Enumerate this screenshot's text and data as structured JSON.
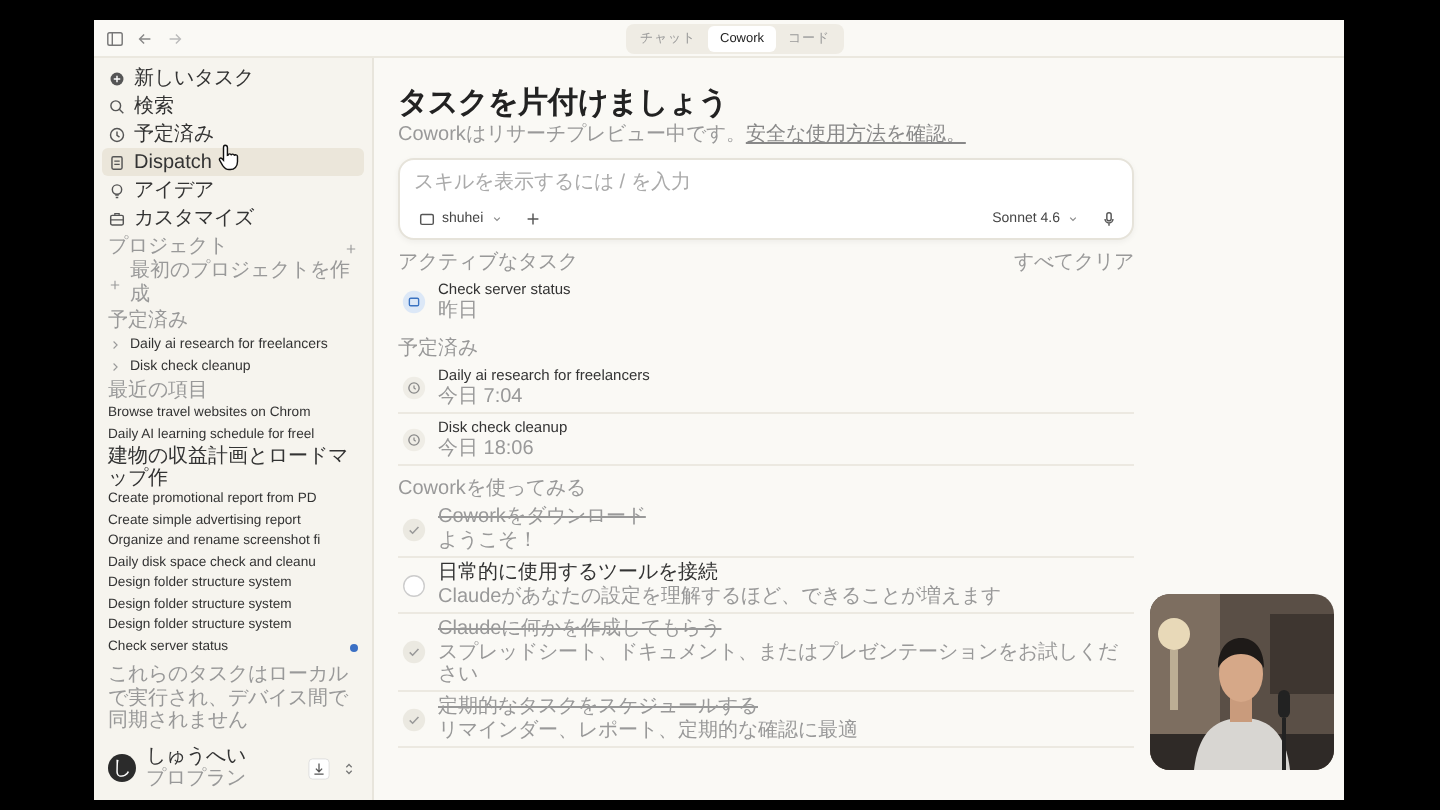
{
  "top_tabs": [
    {
      "label": "チャット",
      "selected": false
    },
    {
      "label": "Cowork",
      "selected": true
    },
    {
      "label": "コード",
      "selected": false
    }
  ],
  "sidebar": {
    "nav": [
      {
        "label": "新しいタスク",
        "selected": false
      },
      {
        "label": "検索",
        "selected": false
      },
      {
        "label": "予定済み",
        "selected": false
      },
      {
        "label": "Dispatch",
        "selected": true
      },
      {
        "label": "アイデア",
        "selected": false
      },
      {
        "label": "カスタマイズ",
        "selected": false
      }
    ],
    "projects": {
      "title": "プロジェクト",
      "create": "最初のプロジェクトを作成"
    },
    "scheduled": {
      "title": "予定済み",
      "items": [
        "Daily ai research for freelancers",
        "Disk check cleanup"
      ]
    },
    "recents": {
      "title": "最近の項目",
      "items": [
        {
          "label": "Browse travel websites on Chrom",
          "running": false
        },
        {
          "label": "Daily AI learning schedule for freel",
          "running": false
        },
        {
          "label": "建物の収益計画とロードマップ作",
          "running": false
        },
        {
          "label": "Create promotional report from PD",
          "running": false
        },
        {
          "label": "Create simple advertising report",
          "running": false
        },
        {
          "label": "Organize and rename screenshot fi",
          "running": false
        },
        {
          "label": "Daily disk space check and cleanu",
          "running": false
        },
        {
          "label": "Design folder structure system",
          "running": false
        },
        {
          "label": "Design folder structure system",
          "running": false
        },
        {
          "label": "Design folder structure system",
          "running": false
        },
        {
          "label": "Check server status",
          "running": true
        }
      ]
    },
    "note": "これらのタスクはローカルで実行され、デバイス間で同期されません",
    "user": {
      "avatar": "し",
      "name": "しゅうへい",
      "plan": "プロプラン"
    }
  },
  "main": {
    "title": "タスクを片付けましょう",
    "subtitle": {
      "text": "Coworkはリサーチプレビュー中です。",
      "link": "安全な使用方法を確認。"
    },
    "composer": {
      "placeholder": "スキルを表示するには / を入力",
      "folder": "shuhei",
      "model": "Sonnet 4.6"
    },
    "active": {
      "title": "アクティブなタスク",
      "clear": "すべてクリア",
      "items": [
        {
          "name": "Check server status",
          "time": "昨日"
        }
      ]
    },
    "scheduled": {
      "title": "予定済み",
      "items": [
        {
          "name": "Daily ai research for freelancers",
          "time": "今日 7:04"
        },
        {
          "name": "Disk check cleanup",
          "time": "今日 18:06"
        }
      ]
    },
    "onboarding": {
      "title": "Coworkを使ってみる",
      "items": [
        {
          "title": "Coworkをダウンロード",
          "subtitle": "ようこそ！",
          "done": true
        },
        {
          "title": "日常的に使用するツールを接続",
          "subtitle": "Claudeがあなたの設定を理解するほど、できることが増えます",
          "done": false
        },
        {
          "title": "Claudeに何かを作成してもらう",
          "subtitle": "スプレッドシート、ドキュメント、またはプレゼンテーションをお試しください",
          "done": true
        },
        {
          "title": "定期的なタスクをスケジュールする",
          "subtitle": "リマインダー、レポート、定期的な確認に最適",
          "done": true
        }
      ]
    }
  }
}
